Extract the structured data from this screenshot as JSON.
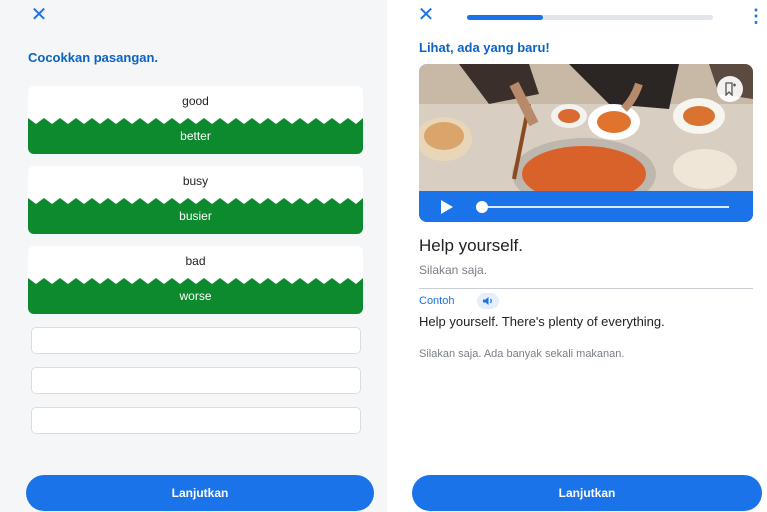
{
  "left_screen": {
    "title": "Cocokkan pasangan.",
    "pairs": [
      {
        "top": "good",
        "bottom": "better"
      },
      {
        "top": "busy",
        "bottom": "busier"
      },
      {
        "top": "bad",
        "bottom": "worse"
      }
    ],
    "continue_label": "Lanjutkan"
  },
  "right_screen": {
    "title": "Lihat, ada yang baru!",
    "progress_fraction": 0.31,
    "phrase": "Help yourself.",
    "translation": "Silakan saja.",
    "example_label": "Contoh",
    "example_text": "Help yourself. There's plenty of everything.",
    "example_translation": "Silakan saja. Ada banyak sekali makanan.",
    "continue_label": "Lanjutkan"
  },
  "icons": {
    "close": "close-icon",
    "menu": "more-vertical-icon",
    "bookmark": "bookmark-add-icon",
    "play": "play-icon",
    "audio": "speaker-icon"
  },
  "colors": {
    "accent": "#1a73e8",
    "title_blue": "#0b63c4",
    "match_green": "#0c8a2d"
  }
}
